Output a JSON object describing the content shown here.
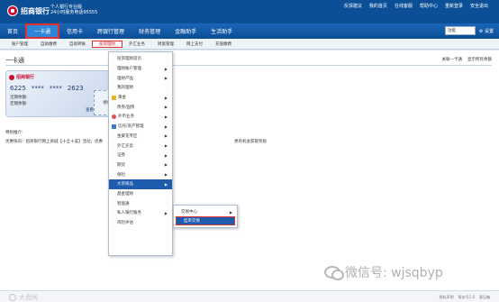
{
  "header": {
    "bank_name": "招商银行",
    "sub_line1": "个人银行专业版",
    "sub_line2": "24小时服务电话95555",
    "top_links": [
      "反馈建议",
      "我的首页",
      "在线客服",
      "帮助中心",
      "重新登录",
      "安全退出"
    ]
  },
  "nav": {
    "items": [
      "首页",
      "一卡通",
      "信用卡",
      "跨银行管理",
      "财务管理",
      "金融助手",
      "生活助手"
    ],
    "function_placeholder": "功能",
    "settings_label": "设置"
  },
  "subnav": {
    "items": [
      "账户管理",
      "自助缴费",
      "自助转账",
      "投资理财",
      "外汇业务",
      "财富管理",
      "网上支付",
      "充值缴费"
    ]
  },
  "content": {
    "page_title": "一卡通",
    "page_links": [
      "关联一卡通",
      "显示所有余额"
    ],
    "card": {
      "bank": "招商银行",
      "number_parts": [
        "6225",
        "****",
        "****",
        "2623"
      ],
      "row1": "活期余额:",
      "row2": "定期余额:",
      "balance_button": "查看余额"
    },
    "card2_label": "继续",
    "tip_title": "特别推介:",
    "tip_text": "优惠快讯：招商银行网上商城【十全十美】活动，优惠",
    "tip_right": "更有机会获取奖励"
  },
  "menu": {
    "items": [
      {
        "label": "投资理财首页",
        "arrow": false
      },
      {
        "label": "理财账户管理",
        "arrow": true
      },
      {
        "label": "理财产品",
        "arrow": true
      },
      {
        "label": "我的理财",
        "arrow": false
      },
      {
        "label": "黄金",
        "arrow": true,
        "icon": "gold-icon"
      },
      {
        "label": "债券/国债",
        "arrow": true
      },
      {
        "label": "外币业务",
        "arrow": true,
        "icon": "currency-icon"
      },
      {
        "label": "信托/资产管理",
        "arrow": true,
        "icon": "trust-icon"
      },
      {
        "label": "金葵花专区",
        "arrow": true
      },
      {
        "label": "外汇买卖",
        "arrow": true
      },
      {
        "label": "证券",
        "arrow": true
      },
      {
        "label": "期货",
        "arrow": true
      },
      {
        "label": "保险",
        "arrow": true
      },
      {
        "label": "大宗商品",
        "arrow": true,
        "active": true
      },
      {
        "label": "基金理财",
        "arrow": false
      },
      {
        "label": "智能通",
        "arrow": false
      },
      {
        "label": "私人银行服务",
        "arrow": true
      },
      {
        "label": "风险评估",
        "arrow": false
      }
    ]
  },
  "submenu": {
    "items": [
      {
        "label": "交易中心",
        "arrow": true
      },
      {
        "label": "挂单交易",
        "arrow": false,
        "selected": true
      }
    ]
  },
  "watermark": {
    "text": "微信号: wjsqbyp"
  },
  "footer": {
    "logo_text": "大盘网",
    "links": [
      "隐私声明",
      "版本号1.0",
      "意见箱"
    ]
  }
}
